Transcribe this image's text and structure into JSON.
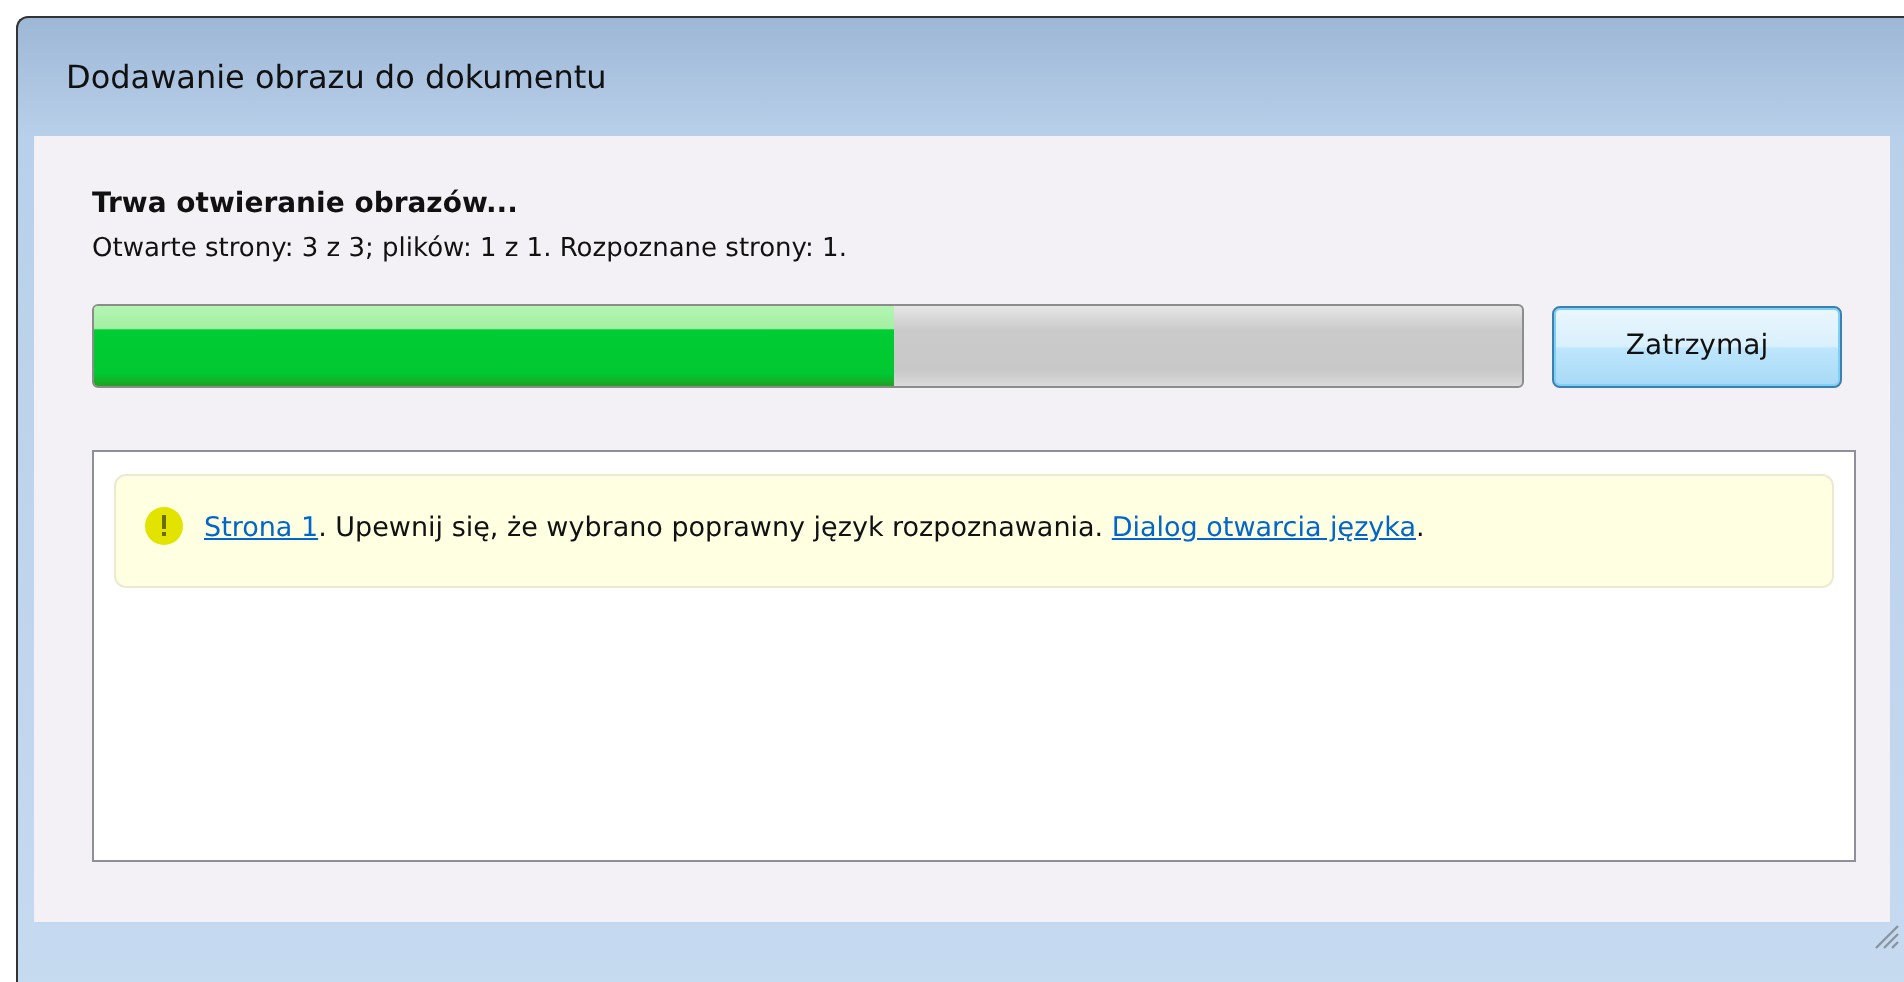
{
  "window": {
    "title": "Dodawanie obrazu do dokumentu"
  },
  "heading": "Trwa otwieranie obrazów...",
  "status": "Otwarte strony: 3 z 3; plików: 1 z 1. Rozpoznane strony: 1.",
  "progress": {
    "level": 0.56
  },
  "buttons": [
    {
      "label": "Zatrzymaj",
      "focused": true
    }
  ],
  "messages": [
    {
      "kind": "warning",
      "parts": [
        {
          "kind": "link",
          "text": "Strona 1"
        },
        {
          "kind": "text",
          "text": ". Upewnij się, że wybrano poprawny język rozpoznawania. "
        },
        {
          "kind": "link",
          "text": "Dialog otwarcia języka"
        },
        {
          "kind": "text",
          "text": "."
        }
      ]
    }
  ]
}
